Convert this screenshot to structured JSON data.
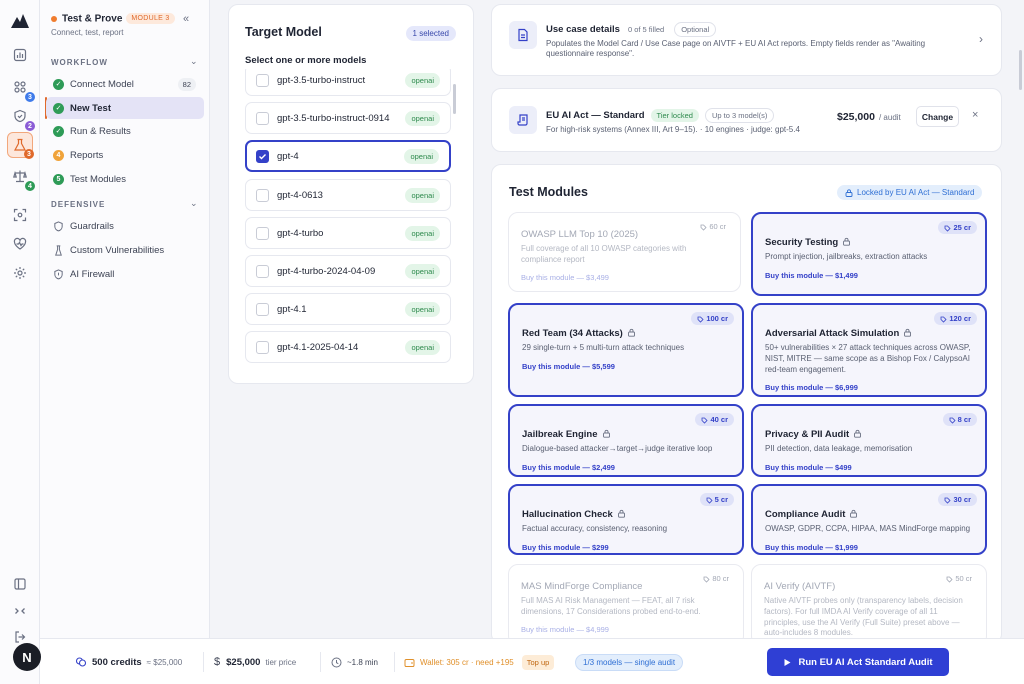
{
  "project": {
    "name": "Test & Prove",
    "module_badge": "MODULE 3",
    "subtitle": "Connect, test, report",
    "avatar_letter": "N"
  },
  "sidebar": {
    "workflow_label": "WORKFLOW",
    "defensive_label": "DEFENSIVE",
    "workflow_items": [
      {
        "label": "Connect Model",
        "count": "82",
        "status": "done"
      },
      {
        "label": "New Test",
        "status": "done"
      },
      {
        "label": "Run & Results",
        "status": "done"
      },
      {
        "label": "Reports",
        "status": "4"
      },
      {
        "label": "Test Modules",
        "status": "5"
      }
    ],
    "defensive_items": [
      {
        "label": "Guardrails"
      },
      {
        "label": "Custom Vulnerabilities"
      },
      {
        "label": "AI Firewall"
      }
    ]
  },
  "rail_badges": {
    "b1": "3",
    "b2": "2",
    "b3": "3",
    "b4": "4"
  },
  "target_model": {
    "title": "Target Model",
    "selected_badge": "1 selected",
    "subtitle": "Select one or more models",
    "models": [
      {
        "name": "gpt-3.5-turbo-instruct",
        "provider": "openai",
        "selected": false
      },
      {
        "name": "gpt-3.5-turbo-instruct-0914",
        "provider": "openai",
        "selected": false
      },
      {
        "name": "gpt-4",
        "provider": "openai",
        "selected": true
      },
      {
        "name": "gpt-4-0613",
        "provider": "openai",
        "selected": false
      },
      {
        "name": "gpt-4-turbo",
        "provider": "openai",
        "selected": false
      },
      {
        "name": "gpt-4-turbo-2024-04-09",
        "provider": "openai",
        "selected": false
      },
      {
        "name": "gpt-4.1",
        "provider": "openai",
        "selected": false
      },
      {
        "name": "gpt-4.1-2025-04-14",
        "provider": "openai",
        "selected": false
      }
    ]
  },
  "use_case": {
    "title": "Use case details",
    "filled": "0 of 5 filled",
    "optional": "Optional",
    "desc": "Populates the Model Card / Use Case page on AIVTF + EU AI Act reports. Empty fields render as \"Awaiting questionnaire response\"."
  },
  "plan": {
    "title": "EU AI Act — Standard",
    "tier": "Tier locked",
    "models_limit": "Up to 3 model(s)",
    "desc": "For high-risk systems (Annex III, Art 9–15). · 10 engines · judge: gpt-5.4",
    "price": "$25,000",
    "price_unit": "/ audit",
    "change": "Change"
  },
  "modules": {
    "title": "Test Modules",
    "locked_badge": "Locked by EU AI Act — Standard",
    "items": [
      {
        "name": "OWASP LLM Top 10 (2025)",
        "credits": "60 cr",
        "desc": "Full coverage of all 10 OWASP categories with compliance report",
        "buy": "Buy this module — $3,499",
        "on": false
      },
      {
        "name": "Security Testing",
        "credits": "25 cr",
        "desc": "Prompt injection, jailbreaks, extraction attacks",
        "buy": "Buy this module — $1,499",
        "on": true
      },
      {
        "name": "Red Team (34 Attacks)",
        "credits": "100 cr",
        "desc": "29 single-turn + 5 multi-turn attack techniques",
        "buy": "Buy this module — $5,599",
        "on": true
      },
      {
        "name": "Adversarial Attack Simulation",
        "credits": "120 cr",
        "desc": "50+ vulnerabilities × 27 attack techniques across OWASP, NIST, MITRE — same scope as a Bishop Fox / CalypsoAI red-team engagement.",
        "buy": "Buy this module — $6,999",
        "on": true
      },
      {
        "name": "Jailbreak Engine",
        "credits": "40 cr",
        "desc": "Dialogue-based attacker→target→judge iterative loop",
        "buy": "Buy this module — $2,499",
        "on": true
      },
      {
        "name": "Privacy & PII Audit",
        "credits": "8 cr",
        "desc": "PII detection, data leakage, memorisation",
        "buy": "Buy this module — $499",
        "on": true
      },
      {
        "name": "Hallucination Check",
        "credits": "5 cr",
        "desc": "Factual accuracy, consistency, reasoning",
        "buy": "Buy this module — $299",
        "on": true
      },
      {
        "name": "Compliance Audit",
        "credits": "30 cr",
        "desc": "OWASP, GDPR, CCPA, HIPAA, MAS MindForge mapping",
        "buy": "Buy this module — $1,999",
        "on": true
      },
      {
        "name": "MAS MindForge Compliance",
        "credits": "80 cr",
        "desc": "Full MAS AI Risk Management — FEAT, all 7 risk dimensions, 17 Considerations probed end-to-end.",
        "buy": "Buy this module — $4,999",
        "on": false
      },
      {
        "name": "AI Verify (AIVTF)",
        "credits": "50 cr",
        "desc": "Native AIVTF probes only (transparency labels, decision factors). For full IMDA AI Verify coverage of all 11 principles, use the AI Verify (Full Suite) preset above — auto-includes 8 modules.",
        "buy": "",
        "on": false
      }
    ]
  },
  "footer": {
    "credits": "500 credits",
    "credits_equiv": "≈ $25,000",
    "price": "$25,000",
    "price_label": "tier price",
    "time": "~1.8 min",
    "wallet": "Wallet: 305 cr · need +195",
    "topup": "Top up",
    "models_pill": "1/3 models — single audit",
    "run_button": "Run EU AI Act Standard Audit"
  }
}
